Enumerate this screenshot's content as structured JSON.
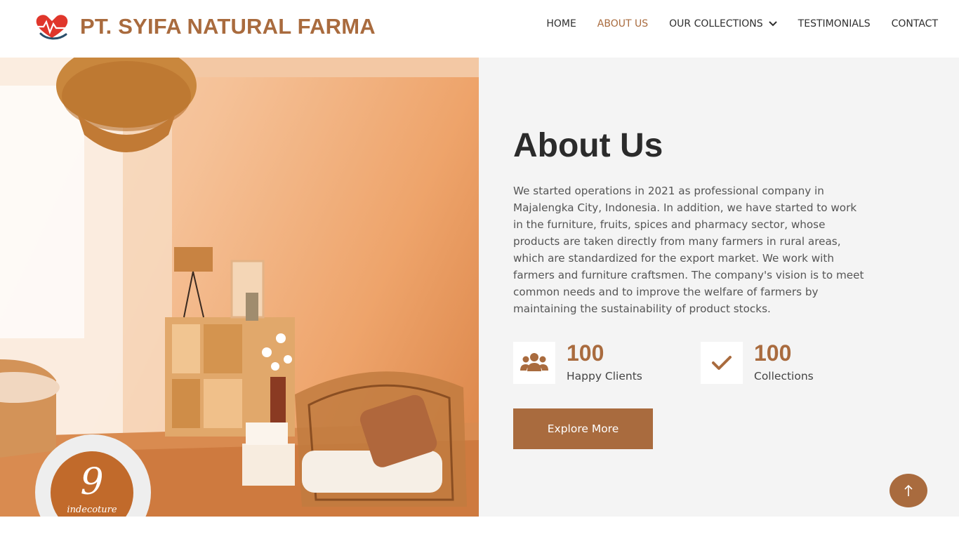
{
  "brand": {
    "name": "PT. SYIFA NATURAL FARMA",
    "logo_icon": "heart-pulse-icon",
    "color": "#a96b3e"
  },
  "nav": {
    "items": [
      {
        "label": "HOME",
        "active": false
      },
      {
        "label": "ABOUT US",
        "active": true
      },
      {
        "label": "OUR COLLECTIONS",
        "active": false,
        "has_dropdown": true
      },
      {
        "label": "TESTIMONIALS",
        "active": false
      },
      {
        "label": "CONTACT",
        "active": false
      }
    ],
    "active_color": "#a96b3e"
  },
  "hero": {
    "image": "living-room-interior-photo",
    "badge": {
      "letter": "9",
      "word": "indecoture"
    }
  },
  "about": {
    "title": "About Us",
    "text": "We started operations in 2021 as professional company in Majalengka City, Indonesia. In addition, we have started to work in the furniture, fruits, spices and pharmacy sector, whose products are taken directly from many farmers in rural areas, which are standardized for the export market. We work with farmers and furniture craftsmen. The company's vision is to meet common needs and to improve the welfare of farmers by maintaining the sustainability of product stocks.",
    "stats": [
      {
        "number": "100",
        "label": "Happy Clients",
        "icon": "users-icon"
      },
      {
        "number": "100",
        "label": "Collections",
        "icon": "check-icon"
      }
    ],
    "button_label": "Explore More"
  },
  "scroll_top": {
    "icon": "arrow-up-icon"
  },
  "colors": {
    "accent": "#a96b3e",
    "panel_bg": "#f4f4f4",
    "heading": "#2b2b2b"
  }
}
